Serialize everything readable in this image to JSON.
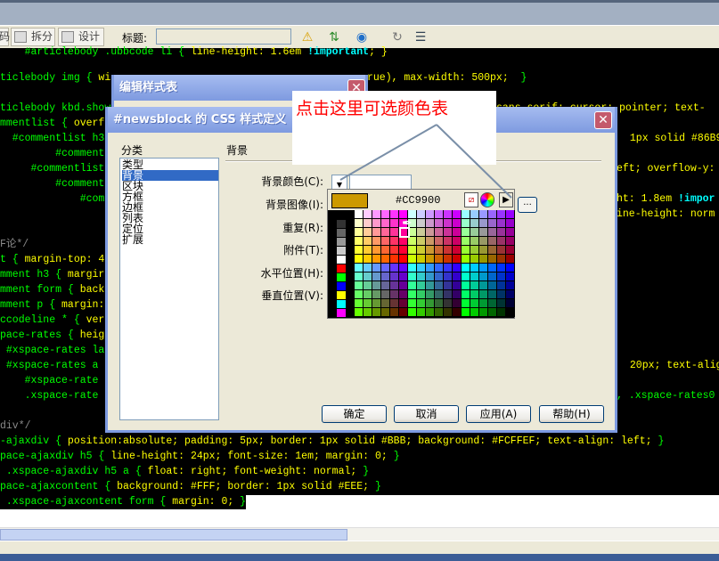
{
  "toolbar": {
    "code_partial": "码",
    "split": "拆分",
    "design": "设计",
    "title_label": "标题:",
    "title_value": "",
    "icons": [
      "validate-warning-icon",
      "file-transfer-icon",
      "preview-globe-icon",
      "refresh-icon",
      "view-options-icon"
    ]
  },
  "code_lines": [
    {
      "l": [
        [
          "g",
          "    #articlebody .ubbcode li { "
        ],
        [
          "y",
          "line-height: 1.6em "
        ],
        [
          "c",
          "!important"
        ],
        [
          "y",
          "; }"
        ]
      ],
      "r": []
    },
    {
      "l": [
        [
          "g",
          "ticlebody img { "
        ],
        [
          "y",
          "wi"
        ]
      ],
      "r": [
        [
          "y",
          "rue), max-width: 500px;  "
        ],
        [
          "g",
          "}"
        ]
      ]
    },
    {
      "l": [],
      "r": []
    },
    {
      "l": [
        [
          "g",
          "ticlebody kbd.show"
        ]
      ],
      "r": [
        [
          "y",
          "sans-serif; cursor: pointer; text-"
        ]
      ]
    },
    {
      "l": [
        [
          "g",
          "mmentlist { "
        ],
        [
          "y",
          "overf"
        ]
      ],
      "r": []
    },
    {
      "l": [
        [
          "g",
          "  #commentlist h3"
        ]
      ],
      "r": [
        [
          "y",
          " 1px solid #86B9D"
        ]
      ]
    },
    {
      "l": [
        [
          "g",
          "         #comment"
        ]
      ],
      "r": []
    },
    {
      "l": [
        [
          "g",
          "     #commentlist"
        ]
      ],
      "r": [
        [
          "y",
          "eft; overflow-y:"
        ]
      ]
    },
    {
      "l": [
        [
          "g",
          "         #comment"
        ]
      ],
      "r": []
    },
    {
      "l": [
        [
          "g",
          "             #com"
        ]
      ],
      "r": [
        [
          "y",
          "ht: 1.8em "
        ],
        [
          "c",
          "!impor"
        ]
      ]
    },
    {
      "l": [],
      "r": [
        [
          "y",
          "ine-height: norm"
        ]
      ]
    },
    {
      "l": [],
      "r": []
    },
    {
      "l": [
        [
          "m",
          "F论*/"
        ]
      ],
      "r": []
    },
    {
      "l": [
        [
          "g",
          "t { "
        ],
        [
          "y",
          "margin-top: 4"
        ]
      ],
      "r": []
    },
    {
      "l": [
        [
          "g",
          "mment h3 { "
        ],
        [
          "y",
          "margir"
        ]
      ],
      "r": []
    },
    {
      "l": [
        [
          "g",
          "mment form { "
        ],
        [
          "y",
          "back"
        ]
      ],
      "r": []
    },
    {
      "l": [
        [
          "g",
          "mment p { "
        ],
        [
          "y",
          "margin:"
        ]
      ],
      "r": []
    },
    {
      "l": [
        [
          "g",
          "ccodeline * { "
        ],
        [
          "y",
          "ver"
        ]
      ],
      "r": []
    },
    {
      "l": [
        [
          "g",
          "pace-rates { "
        ],
        [
          "y",
          "heig"
        ]
      ],
      "r": []
    },
    {
      "l": [
        [
          "g",
          " #xspace-rates la"
        ]
      ],
      "r": []
    },
    {
      "l": [
        [
          "g",
          " #xspace-rates a "
        ]
      ],
      "r": [
        [
          "y",
          " 20px; text-align"
        ]
      ]
    },
    {
      "l": [
        [
          "g",
          "    #xspace-rate"
        ]
      ],
      "r": []
    },
    {
      "l": [
        [
          "g",
          "    .xspace-rate"
        ]
      ],
      "r": [
        [
          "g",
          ", .xspace-rates0"
        ]
      ]
    },
    {
      "l": [],
      "r": []
    },
    {
      "l": [
        [
          "m",
          "div*/"
        ]
      ],
      "r": []
    },
    {
      "l": [
        [
          "g",
          "-ajaxdiv { "
        ],
        [
          "y",
          "position:absolute; padding: 5px; border: 1px solid #BBB; background: #FCFFEF; text-align: left; "
        ],
        [
          "g",
          "}"
        ]
      ],
      "r": []
    },
    {
      "l": [
        [
          "g",
          "pace-ajaxdiv h5 { "
        ],
        [
          "y",
          "line-height: 24px; font-size: 1em; margin: 0; "
        ],
        [
          "g",
          "}"
        ]
      ],
      "r": []
    },
    {
      "l": [
        [
          "g",
          " .xspace-ajaxdiv h5 a { "
        ],
        [
          "y",
          "float: right; font-weight: normal; "
        ],
        [
          "g",
          "}"
        ]
      ],
      "r": []
    },
    {
      "l": [
        [
          "g",
          "pace-ajaxcontent { "
        ],
        [
          "y",
          "background: #FFF; border: 1px solid #EEE; "
        ],
        [
          "g",
          "}"
        ]
      ],
      "r": []
    },
    {
      "l": [
        [
          "g",
          " .xspace-ajaxcontent form { "
        ],
        [
          "y",
          "margin: 0; "
        ],
        [
          "g",
          "}"
        ]
      ],
      "r": []
    }
  ],
  "edit_dialog": {
    "title": "编辑样式表"
  },
  "css_dialog": {
    "title": "#newsblock 的 CSS 样式定义",
    "category_label": "分类",
    "categories": [
      "类型",
      "背景",
      "区块",
      "方框",
      "边框",
      "列表",
      "定位",
      "扩展"
    ],
    "selected_category": "背景",
    "section_title": "背景",
    "fields": [
      "背景颜色(C):",
      "背景图像(I):",
      "重复(R):",
      "附件(T):",
      "水平位置(H):",
      "垂直位置(V):"
    ],
    "buttons": {
      "ok": "确定",
      "cancel": "取消",
      "apply": "应用(A)",
      "help": "帮助(H)"
    },
    "browse": "..."
  },
  "color_picker": {
    "value": "#CC9900",
    "swatch_color": "#CC9900",
    "basic_colors": [
      "#333333",
      "#666666",
      "#999999",
      "#CCCCCC",
      "#FFFFFF",
      "#FF0000",
      "#00FF00",
      "#0000FF",
      "#FFFF00",
      "#00FFFF",
      "#FF00FF"
    ]
  },
  "annotation": {
    "text": "点击这里可选颜色表",
    "color": "#FF0000"
  }
}
